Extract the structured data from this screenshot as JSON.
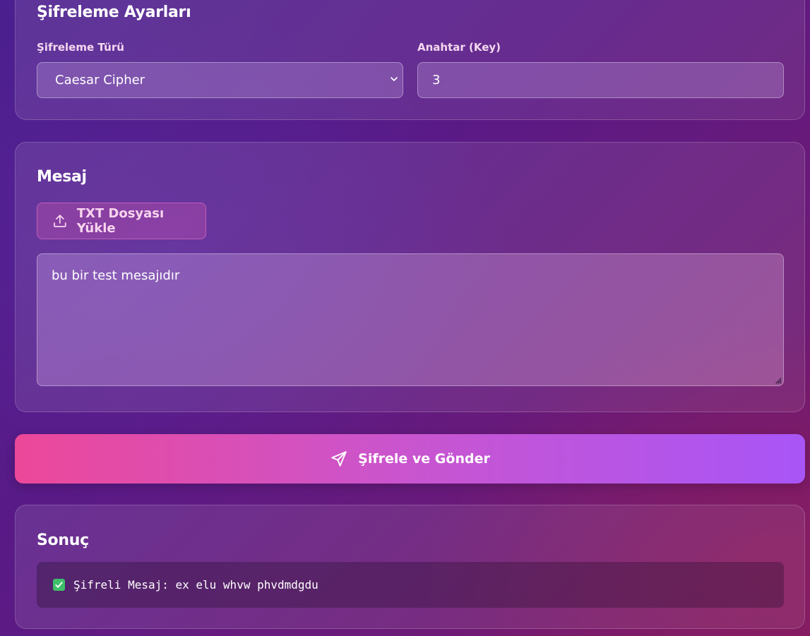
{
  "settings": {
    "title": "Şifreleme Ayarları",
    "cipher_type_label": "Şifreleme Türü",
    "cipher_type_value": "Caesar Cipher",
    "key_label": "Anahtar (Key)",
    "key_value": "3"
  },
  "message": {
    "title": "Mesaj",
    "upload_label": "TXT Dosyası Yükle",
    "text_value": "bu bir test mesajıdır"
  },
  "submit": {
    "label": "Şifrele ve Gönder"
  },
  "result": {
    "title": "Sonuç",
    "text": "Şifreli Mesaj: ex elu whvw phvdmdgdu"
  },
  "icons": {
    "dropdown": "chevron-down-icon",
    "upload": "upload-icon",
    "submit": "send-icon",
    "result": "check-box-icon"
  },
  "colors": {
    "button_gradient_start": "#ec4899",
    "button_gradient_end": "#a855f7",
    "success": "#3fbf6a"
  }
}
